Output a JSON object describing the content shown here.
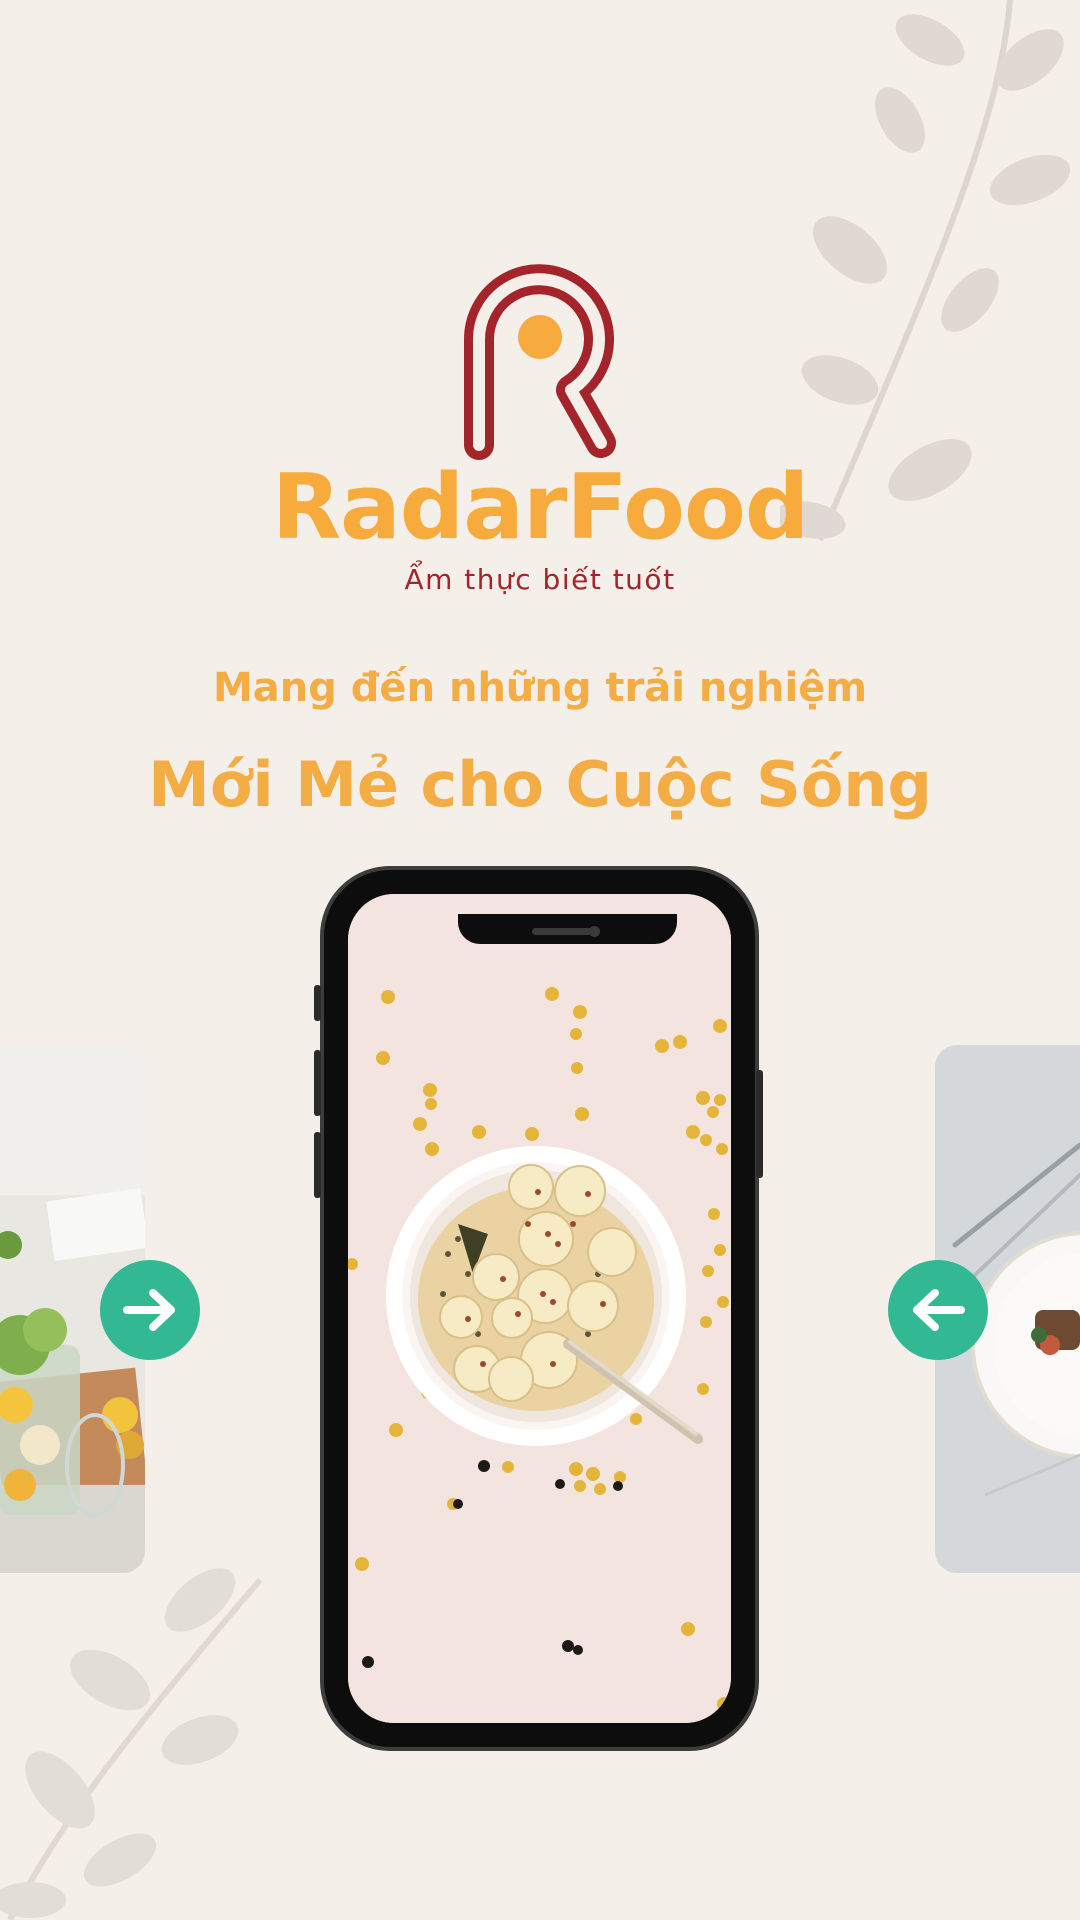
{
  "brand": {
    "name": "RadarFood",
    "tagline": "Ẩm thực biết tuốt"
  },
  "headline": {
    "line1": "Mang đến những trải nghiệm",
    "line2": "Mới Mẻ cho Cuộc Sống"
  },
  "carousel": {
    "next_icon": "arrow-right-icon",
    "prev_icon": "arrow-left-icon",
    "slides": [
      "salad-jar-photo",
      "banana-oatmeal-photo",
      "plated-dish-photo"
    ]
  },
  "colors": {
    "background": "#f4efe8",
    "brand_orange": "#f7ab3c",
    "brand_red": "#a3242b",
    "nav_green": "#32b892"
  }
}
